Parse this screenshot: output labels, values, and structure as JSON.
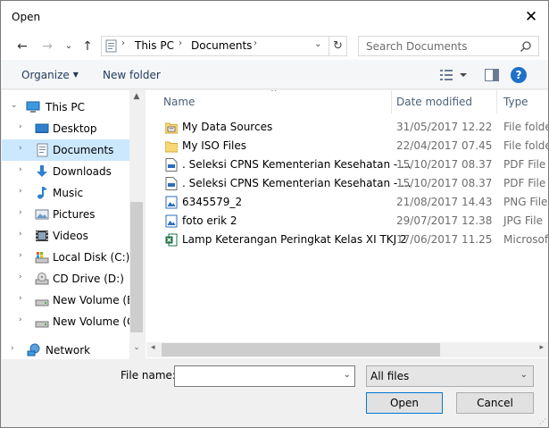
{
  "window": {
    "title": "Open",
    "close_glyph": "✕"
  },
  "nav": {
    "back_glyph": "←",
    "forward_glyph": "→",
    "history_glyph": "⌄",
    "up_glyph": "↑"
  },
  "address": {
    "crumbs": [
      "This PC",
      "Documents"
    ],
    "separator": "›",
    "dropdown_glyph": "⌄",
    "refresh_glyph": "↻"
  },
  "search": {
    "placeholder": "Search Documents"
  },
  "toolbar": {
    "organize": "Organize",
    "new_folder": "New folder",
    "caret": "▼",
    "help": "?"
  },
  "sidebar": {
    "items": [
      {
        "label": "This PC",
        "icon": "computer-icon",
        "chevron": "⌄"
      },
      {
        "label": "Desktop",
        "icon": "desktop-icon",
        "chevron": "›"
      },
      {
        "label": "Documents",
        "icon": "documents-icon",
        "chevron": "›",
        "selected": true
      },
      {
        "label": "Downloads",
        "icon": "downloads-icon",
        "chevron": "›"
      },
      {
        "label": "Music",
        "icon": "music-icon",
        "chevron": "›"
      },
      {
        "label": "Pictures",
        "icon": "pictures-icon",
        "chevron": "›"
      },
      {
        "label": "Videos",
        "icon": "videos-icon",
        "chevron": "›"
      },
      {
        "label": "Local Disk (C:)",
        "icon": "local-disk-icon",
        "chevron": "›"
      },
      {
        "label": "CD Drive (D:)",
        "icon": "cd-drive-icon",
        "chevron": "›"
      },
      {
        "label": "New Volume (E:)",
        "icon": "drive-icon",
        "chevron": "›"
      },
      {
        "label": "New Volume (G:)",
        "icon": "drive-icon",
        "chevron": "›"
      },
      {
        "label": "Network",
        "icon": "network-icon",
        "chevron": "›"
      }
    ],
    "scroll_up": "▲",
    "scroll_down": "⌄"
  },
  "columns": {
    "name": "Name",
    "date": "Date modified",
    "type": "Type",
    "sort_arrow": "^"
  },
  "files": [
    {
      "name": "My Data Sources",
      "date": "31/05/2017 12.22",
      "type": "File folder",
      "icon": "folder-datasource-icon"
    },
    {
      "name": "My ISO Files",
      "date": "22/04/2017 07.45",
      "type": "File folder",
      "icon": "folder-icon"
    },
    {
      "name": ". Seleksi CPNS Kementerian Kesehatan - ...",
      "date": "15/10/2017 08.37",
      "type": "PDF File",
      "icon": "pdf-file-icon"
    },
    {
      "name": ". Seleksi CPNS Kementerian Kesehatan - ...",
      "date": "15/10/2017 08.37",
      "type": "PDF File",
      "icon": "pdf-file-icon"
    },
    {
      "name": "6345579_2",
      "date": "21/08/2017 14.43",
      "type": "PNG File",
      "icon": "image-file-icon"
    },
    {
      "name": "foto erik 2",
      "date": "29/07/2017 12.38",
      "type": "JPG File",
      "icon": "image-file-icon"
    },
    {
      "name": "Lamp Keterangan Peringkat Kelas XI TKJ 2",
      "date": "17/06/2017 11.25",
      "type": "Microsoft",
      "icon": "excel-file-icon"
    }
  ],
  "hscroll": {
    "left": "◂",
    "right": "▸"
  },
  "bottom": {
    "file_name_label": "File name:",
    "file_name_value": "",
    "filter_value": "All files",
    "dropdown_glyph": "⌄",
    "open": "Open",
    "cancel": "Cancel"
  },
  "colors": {
    "accent": "#0078d7",
    "selection": "#cce8ff",
    "folder": "#f8d775"
  }
}
